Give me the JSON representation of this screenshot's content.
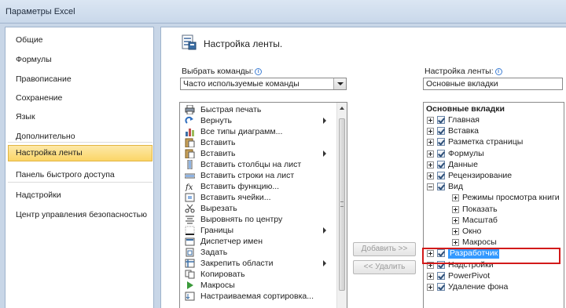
{
  "window": {
    "title": "Параметры Excel"
  },
  "sidebar": {
    "items": [
      {
        "label": "Общие",
        "active": false
      },
      {
        "label": "Формулы",
        "active": false
      },
      {
        "label": "Правописание",
        "active": false
      },
      {
        "label": "Сохранение",
        "active": false
      },
      {
        "label": "Язык",
        "active": false
      },
      {
        "label": "Дополнительно",
        "active": false
      },
      {
        "label": "Настройка ленты",
        "active": true
      },
      {
        "label": "Панель быстрого доступа",
        "active": false
      },
      {
        "label": "Надстройки",
        "active": false
      },
      {
        "label": "Центр управления безопасностью",
        "active": false
      }
    ]
  },
  "main": {
    "header": "Настройка ленты.",
    "choose_commands": {
      "label": "Выбрать команды:",
      "value": "Часто используемые команды"
    },
    "customize_ribbon": {
      "label": "Настройка ленты:",
      "value": "Основные вкладки"
    },
    "commands": [
      {
        "label": "Быстрая печать",
        "icon": "quick-print-icon",
        "submenu": false
      },
      {
        "label": "Вернуть",
        "icon": "redo-icon",
        "submenu": true
      },
      {
        "label": "Все типы диаграмм...",
        "icon": "chart-types-icon",
        "submenu": false
      },
      {
        "label": "Вставить",
        "icon": "paste-icon",
        "submenu": false
      },
      {
        "label": "Вставить",
        "icon": "paste-icon",
        "submenu": true
      },
      {
        "label": "Вставить столбцы на лист",
        "icon": "insert-columns-icon",
        "submenu": false
      },
      {
        "label": "Вставить строки на лист",
        "icon": "insert-rows-icon",
        "submenu": false
      },
      {
        "label": "Вставить функцию...",
        "icon": "insert-function-icon",
        "submenu": false
      },
      {
        "label": "Вставить ячейки...",
        "icon": "insert-cells-icon",
        "submenu": false
      },
      {
        "label": "Вырезать",
        "icon": "cut-icon",
        "submenu": false
      },
      {
        "label": "Выровнять по центру",
        "icon": "align-center-icon",
        "submenu": false
      },
      {
        "label": "Границы",
        "icon": "borders-icon",
        "submenu": true
      },
      {
        "label": "Диспетчер имен",
        "icon": "name-manager-icon",
        "submenu": false
      },
      {
        "label": "Задать",
        "icon": "set-print-area-icon",
        "submenu": false
      },
      {
        "label": "Закрепить области",
        "icon": "freeze-panes-icon",
        "submenu": true
      },
      {
        "label": "Копировать",
        "icon": "copy-icon",
        "submenu": false
      },
      {
        "label": "Макросы",
        "icon": "macros-icon",
        "submenu": false
      },
      {
        "label": "Настраиваемая сортировка...",
        "icon": "custom-sort-icon",
        "submenu": false
      }
    ],
    "buttons": {
      "add": "Добавить >>",
      "remove": "<< Удалить"
    },
    "tree_header": "Основные вкладки",
    "tree": [
      {
        "label": "Главная",
        "level": 0,
        "expander": "plus",
        "checkbox": true,
        "selected": false
      },
      {
        "label": "Вставка",
        "level": 0,
        "expander": "plus",
        "checkbox": true,
        "selected": false
      },
      {
        "label": "Разметка страницы",
        "level": 0,
        "expander": "plus",
        "checkbox": true,
        "selected": false
      },
      {
        "label": "Формулы",
        "level": 0,
        "expander": "plus",
        "checkbox": true,
        "selected": false
      },
      {
        "label": "Данные",
        "level": 0,
        "expander": "plus",
        "checkbox": true,
        "selected": false
      },
      {
        "label": "Рецензирование",
        "level": 0,
        "expander": "plus",
        "checkbox": true,
        "selected": false
      },
      {
        "label": "Вид",
        "level": 0,
        "expander": "minus",
        "checkbox": true,
        "selected": false
      },
      {
        "label": "Режимы просмотра книги",
        "level": 1,
        "expander": "plus",
        "checkbox": false,
        "selected": false
      },
      {
        "label": "Показать",
        "level": 1,
        "expander": "plus",
        "checkbox": false,
        "selected": false
      },
      {
        "label": "Масштаб",
        "level": 1,
        "expander": "plus",
        "checkbox": false,
        "selected": false
      },
      {
        "label": "Окно",
        "level": 1,
        "expander": "plus",
        "checkbox": false,
        "selected": false
      },
      {
        "label": "Макросы",
        "level": 1,
        "expander": "plus",
        "checkbox": false,
        "selected": false
      },
      {
        "label": "Разработчик",
        "level": 0,
        "expander": "plus",
        "checkbox": true,
        "selected": true
      },
      {
        "label": "Надстройки",
        "level": 0,
        "expander": "plus",
        "checkbox": true,
        "selected": false
      },
      {
        "label": "PowerPivot",
        "level": 0,
        "expander": "plus",
        "checkbox": true,
        "selected": false
      },
      {
        "label": "Удаление фона",
        "level": 0,
        "expander": "plus",
        "checkbox": true,
        "selected": false
      }
    ],
    "colors": {
      "selection": "#3399ff",
      "highlight": "#d21a1a",
      "active_nav": "#fbd567"
    }
  }
}
